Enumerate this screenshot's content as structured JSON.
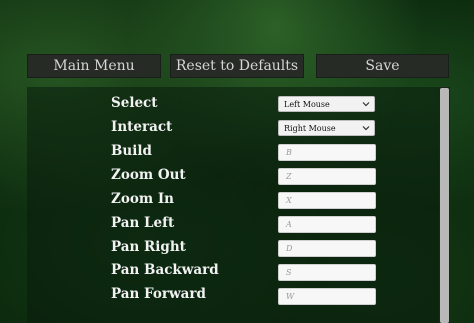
{
  "toolbar": {
    "main_menu": "Main Menu",
    "reset_defaults": "Reset to Defaults",
    "save": "Save"
  },
  "bindings": [
    {
      "action": "Select",
      "control": "select",
      "value": "Left Mouse"
    },
    {
      "action": "Interact",
      "control": "select",
      "value": "Right Mouse"
    },
    {
      "action": "Build",
      "control": "input",
      "value": "B"
    },
    {
      "action": "Zoom Out",
      "control": "input",
      "value": "Z"
    },
    {
      "action": "Zoom In",
      "control": "input",
      "value": "X"
    },
    {
      "action": "Pan Left",
      "control": "input",
      "value": "A"
    },
    {
      "action": "Pan Right",
      "control": "input",
      "value": "D"
    },
    {
      "action": "Pan Backward",
      "control": "input",
      "value": "S"
    },
    {
      "action": "Pan Forward",
      "control": "input",
      "value": "W"
    }
  ],
  "icons": {
    "dropdown": "chevron-down-icon"
  },
  "colors": {
    "background": "#0c2a0e",
    "button": "#262b26",
    "button_text": "#d6d6d6",
    "label_text": "#f2f2f2",
    "scroll_thumb": "#b8b8b8"
  }
}
